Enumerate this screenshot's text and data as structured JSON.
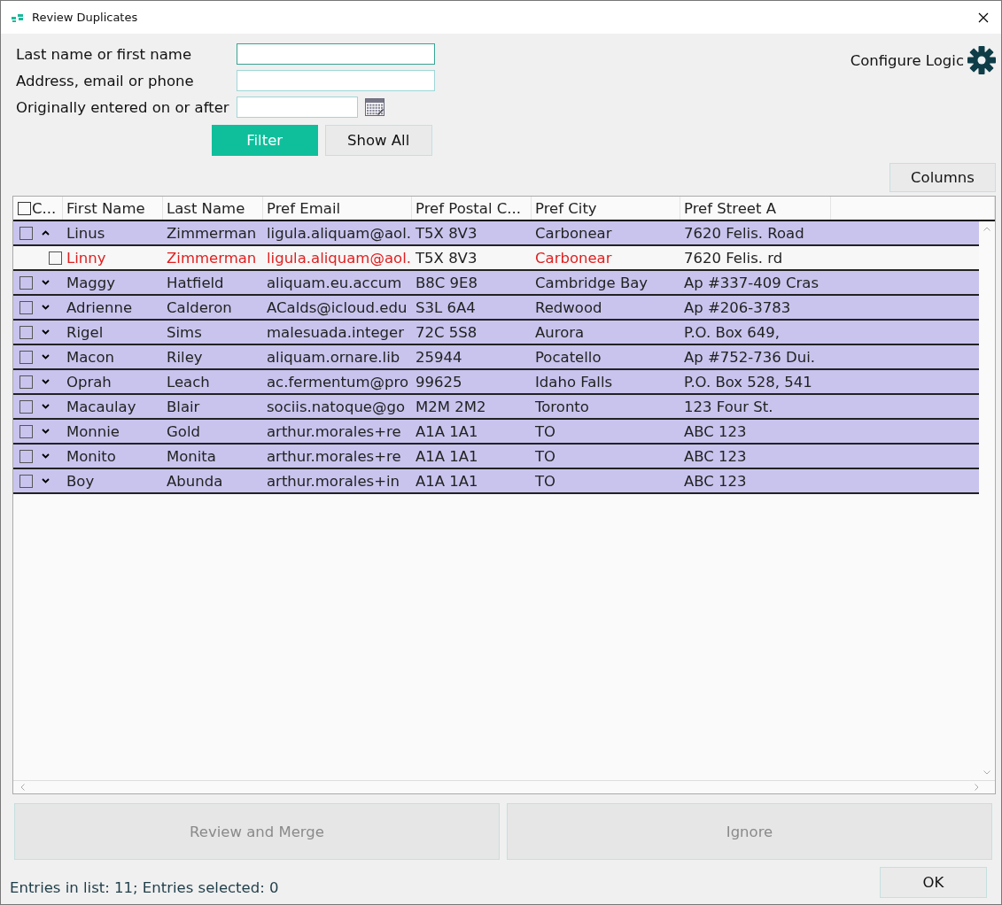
{
  "window": {
    "title": "Review Duplicates"
  },
  "filters": [
    {
      "label": "Last name or first name",
      "focused": true,
      "kind": "text"
    },
    {
      "label": "Address, email or phone",
      "focused": false,
      "kind": "text"
    },
    {
      "label": "Originally entered on or after",
      "focused": false,
      "kind": "date"
    }
  ],
  "filter_buttons": [
    {
      "label": "Filter",
      "primary": true
    },
    {
      "label": "Show All",
      "primary": false
    }
  ],
  "configure_logic": {
    "label": "Configure Logic"
  },
  "columns_button": {
    "label": "Columns"
  },
  "table": {
    "select_all_checked": false,
    "check_column_header": "C...",
    "columns": [
      "First Name",
      "Last Name",
      "Pref Email",
      "Pref Postal C...",
      "Pref City",
      "Pref Street A"
    ],
    "rows": [
      {
        "checked": false,
        "expanded": true,
        "cells": [
          "Linus",
          "Zimmerman",
          "ligula.aliquam@aol.",
          "T5X 8V3",
          "Carbonear",
          "7620 Felis. Road"
        ],
        "children": [
          {
            "checked": false,
            "cells": [
              {
                "text": "Linny",
                "highlighted": true
              },
              {
                "text": "Zimmerman",
                "highlighted": true
              },
              {
                "text": "ligula.aliquam@aol.",
                "highlighted": true
              },
              {
                "text": "T5X 8V3",
                "highlighted": false
              },
              {
                "text": "Carbonear",
                "highlighted": true
              },
              {
                "text": "7620 Felis. rd",
                "highlighted": false
              }
            ]
          }
        ]
      },
      {
        "checked": false,
        "expanded": false,
        "cells": [
          "Maggy",
          "Hatfield",
          "aliquam.eu.accum",
          "B8C 9E8",
          "Cambridge Bay",
          "Ap #337-409 Cras"
        ]
      },
      {
        "checked": false,
        "expanded": false,
        "cells": [
          "Adrienne",
          "Calderon",
          "ACalds@icloud.edu",
          "S3L 6A4",
          "Redwood",
          "Ap #206-3783"
        ]
      },
      {
        "checked": false,
        "expanded": false,
        "cells": [
          "Rigel",
          "Sims",
          "malesuada.integer",
          "72C 5S8",
          "Aurora",
          "P.O. Box 649,"
        ]
      },
      {
        "checked": false,
        "expanded": false,
        "cells": [
          "Macon",
          "Riley",
          "aliquam.ornare.lib",
          "25944",
          "Pocatello",
          "Ap #752-736 Dui."
        ]
      },
      {
        "checked": false,
        "expanded": false,
        "cells": [
          "Oprah",
          "Leach",
          "ac.fermentum@pro",
          "99625",
          "Idaho Falls",
          "P.O. Box 528, 541"
        ]
      },
      {
        "checked": false,
        "expanded": false,
        "cells": [
          "Macaulay",
          "Blair",
          "sociis.natoque@go",
          "M2M 2M2",
          "Toronto",
          "123 Four St."
        ]
      },
      {
        "checked": false,
        "expanded": false,
        "cells": [
          "Monnie",
          "Gold",
          "arthur.morales+re",
          "A1A 1A1",
          "TO",
          "ABC 123"
        ]
      },
      {
        "checked": false,
        "expanded": false,
        "cells": [
          "Monito",
          "Monita",
          "arthur.morales+re",
          "A1A 1A1",
          "TO",
          "ABC 123"
        ]
      },
      {
        "checked": false,
        "expanded": false,
        "cells": [
          "Boy",
          "Abunda",
          "arthur.morales+in",
          "A1A 1A1",
          "TO",
          "ABC 123"
        ]
      }
    ]
  },
  "action_buttons": [
    {
      "label": "Review and Merge",
      "disabled": true
    },
    {
      "label": "Ignore",
      "disabled": true
    }
  ],
  "status_bar": {
    "text": "Entries in list: 11; Entries selected: 0"
  },
  "ok_button": {
    "label": "OK"
  }
}
